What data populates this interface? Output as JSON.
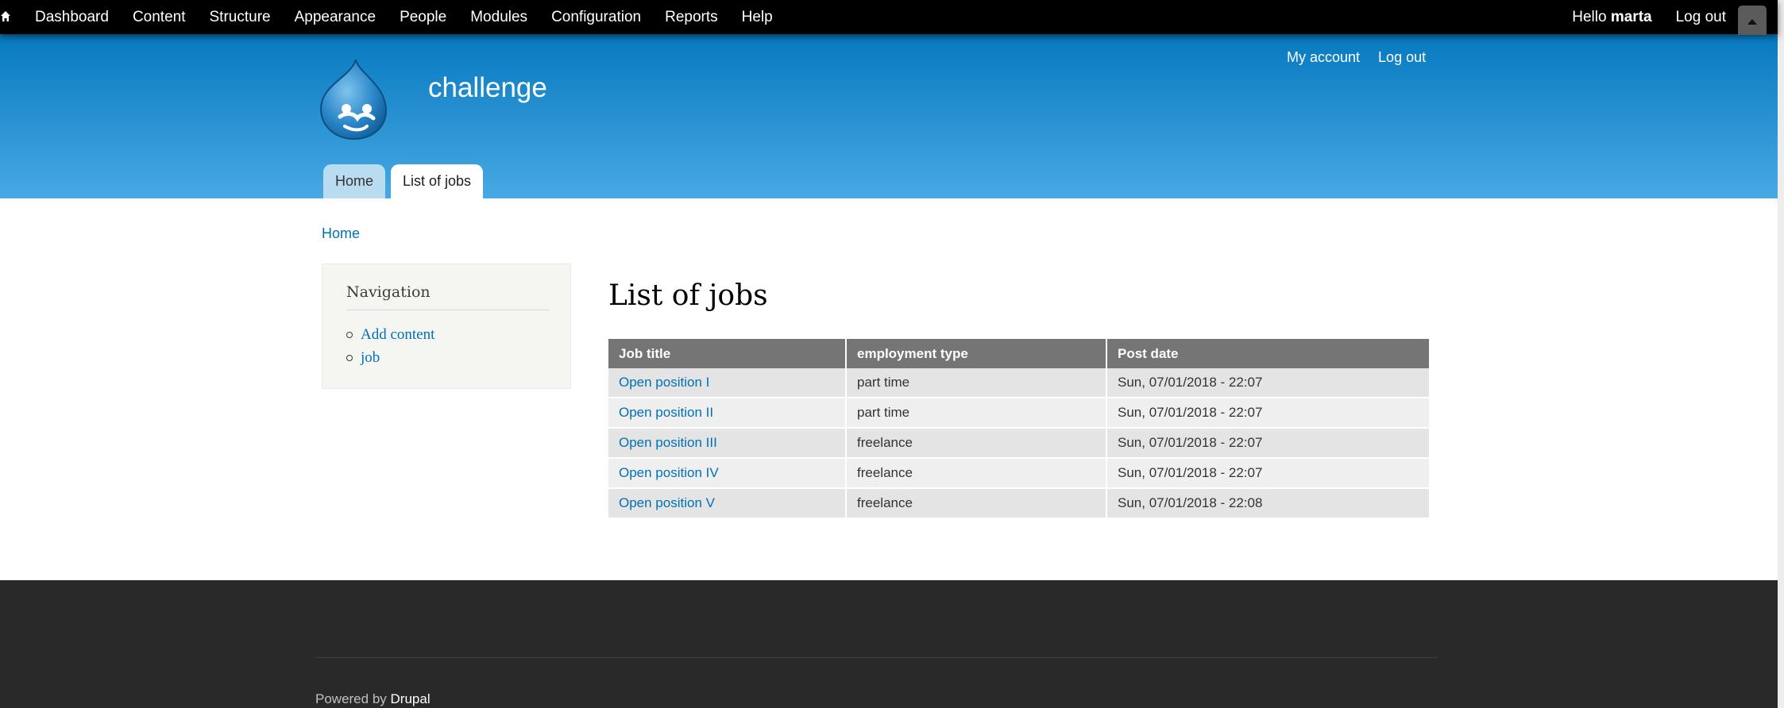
{
  "toolbar": {
    "menu": [
      "Dashboard",
      "Content",
      "Structure",
      "Appearance",
      "People",
      "Modules",
      "Configuration",
      "Reports",
      "Help"
    ],
    "hello_prefix": "Hello",
    "user": "marta",
    "logout": "Log out"
  },
  "header": {
    "site_name": "challenge",
    "secondary_menu": [
      "My account",
      "Log out"
    ],
    "tabs": [
      {
        "label": "Home",
        "active": false
      },
      {
        "label": "List of jobs",
        "active": true
      }
    ]
  },
  "breadcrumb": "Home",
  "sidebar": {
    "title": "Navigation",
    "items": [
      "Add content",
      "job"
    ]
  },
  "main": {
    "title": "List of jobs",
    "table": {
      "headers": [
        "Job title",
        "employment type",
        "Post date"
      ],
      "rows": [
        [
          "Open position I",
          "part time",
          "Sun, 07/01/2018 - 22:07"
        ],
        [
          "Open position II",
          "part time",
          "Sun, 07/01/2018 - 22:07"
        ],
        [
          "Open position III",
          "freelance",
          "Sun, 07/01/2018 - 22:07"
        ],
        [
          "Open position IV",
          "freelance",
          "Sun, 07/01/2018 - 22:07"
        ],
        [
          "Open position V",
          "freelance",
          "Sun, 07/01/2018 - 22:08"
        ]
      ]
    }
  },
  "footer": {
    "powered_by": "Powered by",
    "drupal": "Drupal"
  },
  "colors": {
    "header_top": "#0779bf",
    "header_bottom": "#48a9e4",
    "link": "#0071b3",
    "table_header": "#757575",
    "footer": "#292929"
  }
}
